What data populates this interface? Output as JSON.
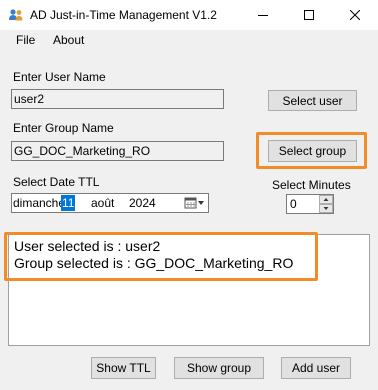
{
  "window": {
    "title": "AD Just-in-Time Management V1.2",
    "icons": {
      "app": "users-icon",
      "minimize": "minimize-icon",
      "maximize": "maximize-icon",
      "close": "close-icon"
    }
  },
  "menu": {
    "file": "File",
    "about": "About"
  },
  "user": {
    "label": "Enter User Name",
    "value": "user2",
    "button": "Select user"
  },
  "group": {
    "label": "Enter Group Name",
    "value": "GG_DOC_Marketing_RO",
    "button": "Select group"
  },
  "date": {
    "label": "Select Date TTL",
    "day_name": "dimanche",
    "day": "11",
    "month": "août",
    "year": "2024",
    "icon": "calendar-dropdown-icon"
  },
  "minutes": {
    "label": "Select Minutes",
    "value": "0"
  },
  "output": {
    "lines": [
      "User selected is : user2",
      "Group selected is : GG_DOC_Marketing_RO"
    ]
  },
  "buttons": {
    "show_ttl": "Show TTL",
    "show_group": "Show group",
    "add_user": "Add user"
  },
  "colors": {
    "highlight": "#f28c28",
    "selection": "#0078d7"
  }
}
